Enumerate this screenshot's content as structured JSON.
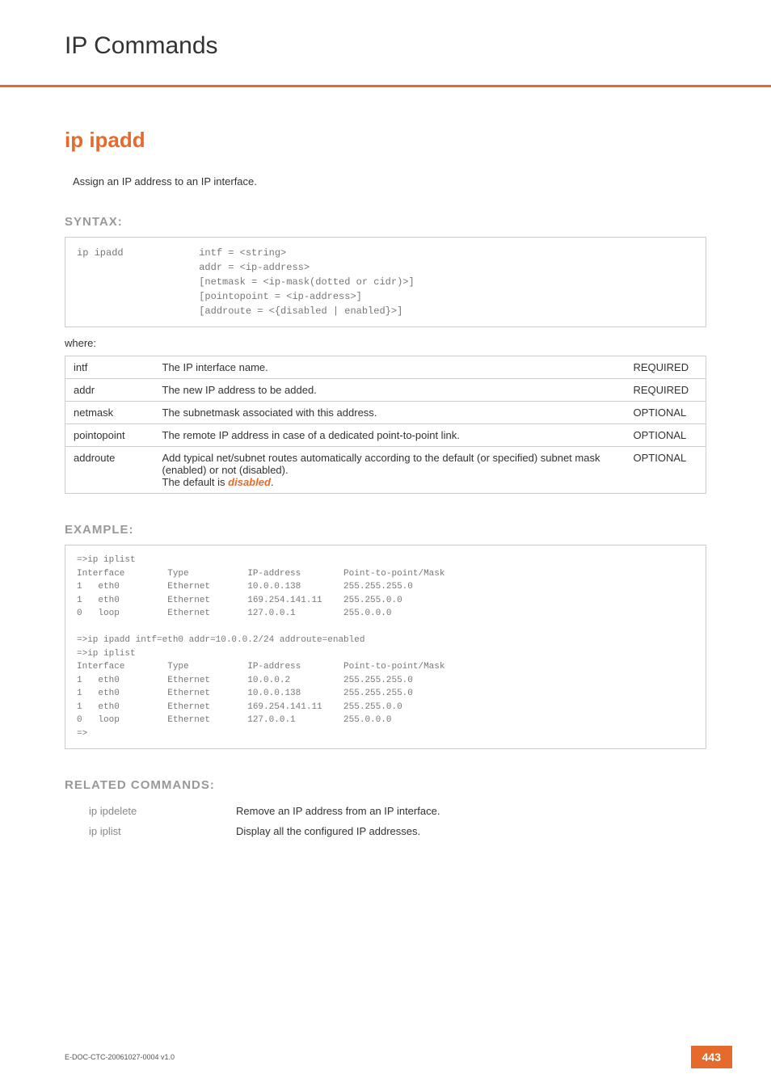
{
  "header": {
    "title": "IP Commands"
  },
  "command": {
    "name": "ip ipadd",
    "description": "Assign an IP address to an IP interface."
  },
  "syntax": {
    "heading": "SYNTAX:",
    "code": "ip ipadd             intf = <string>\n                     addr = <ip-address>\n                     [netmask = <ip-mask(dotted or cidr)>]\n                     [pointopoint = <ip-address>]\n                     [addroute = <{disabled | enabled}>]",
    "where": "where:",
    "params": [
      {
        "name": "intf",
        "desc": "The IP interface name.",
        "req": "REQUIRED"
      },
      {
        "name": "addr",
        "desc": "The new IP address to be added.",
        "req": "REQUIRED"
      },
      {
        "name": "netmask",
        "desc": "The subnetmask associated with this address.",
        "req": "OPTIONAL"
      },
      {
        "name": "pointopoint",
        "desc": "The remote IP address in case of a dedicated point-to-point link.",
        "req": "OPTIONAL"
      },
      {
        "name": "addroute",
        "desc_pre": "Add typical net/subnet routes automatically according to the default (or specified) subnet mask (enabled) or not (disabled).\nThe default is ",
        "desc_key": "disabled",
        "desc_post": ".",
        "req": "OPTIONAL"
      }
    ]
  },
  "example": {
    "heading": "EXAMPLE:",
    "code": "=>ip iplist\nInterface        Type           IP-address        Point-to-point/Mask\n1   eth0         Ethernet       10.0.0.138        255.255.255.0\n1   eth0         Ethernet       169.254.141.11    255.255.0.0\n0   loop         Ethernet       127.0.0.1         255.0.0.0\n\n=>ip ipadd intf=eth0 addr=10.0.0.2/24 addroute=enabled\n=>ip iplist\nInterface        Type           IP-address        Point-to-point/Mask\n1   eth0         Ethernet       10.0.0.2          255.255.255.0\n1   eth0         Ethernet       10.0.0.138        255.255.255.0\n1   eth0         Ethernet       169.254.141.11    255.255.0.0\n0   loop         Ethernet       127.0.0.1         255.0.0.0\n=>"
  },
  "related": {
    "heading": "RELATED COMMANDS:",
    "items": [
      {
        "cmd": "ip ipdelete",
        "desc": "Remove an IP address from an IP interface."
      },
      {
        "cmd": "ip iplist",
        "desc": "Display all the configured IP addresses."
      }
    ]
  },
  "footer": {
    "doc": "E-DOC-CTC-20061027-0004 v1.0",
    "page": "443"
  }
}
